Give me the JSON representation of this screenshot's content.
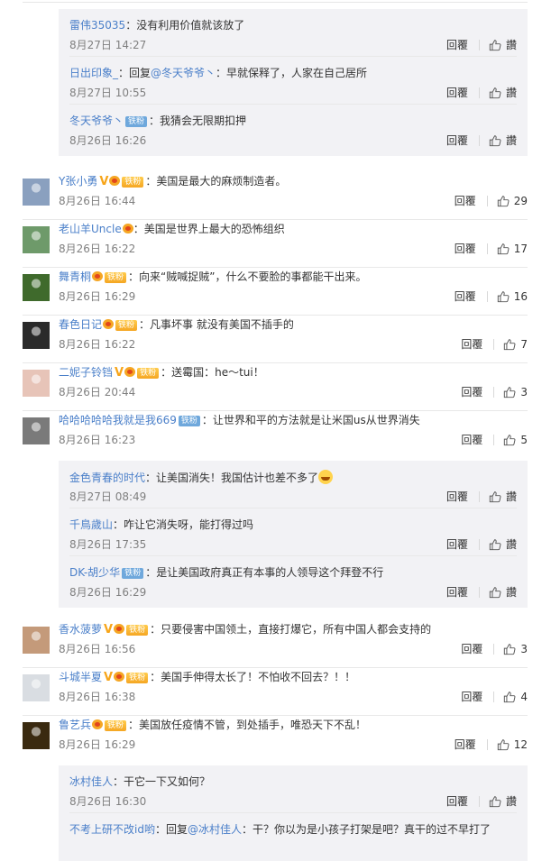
{
  "reply_label": "回覆",
  "like_label": "讚",
  "top_items": [
    {
      "name": "雷伟35035",
      "badges": [],
      "text": "：没有利用价值就该放了",
      "time": "8月27日 14:27"
    },
    {
      "name": "日出印象_",
      "badges": [],
      "text": "：回复",
      "mention": "@冬天爷爷丶",
      "text2": "：早就保释了，人家在自己居所",
      "time": "8月27日 10:55"
    },
    {
      "name": "冬天爷爷丶",
      "badges": [
        "fan-blue"
      ],
      "text": "：我猜会无限期扣押",
      "time": "8月26日 16:26"
    }
  ],
  "fan_label": "铁粉",
  "comments": [
    {
      "name": "Y张小勇",
      "badges": [
        "v",
        "crown",
        "fan-gold"
      ],
      "text": "：美国是最大的麻烦制造者。",
      "time": "8月26日 16:44",
      "likes": "29",
      "avatar": "#8aa0bf",
      "replies": []
    },
    {
      "name": "老山羊Uncle",
      "badges": [
        "crown"
      ],
      "text": "：美国是世界上最大的恐怖组织",
      "time": "8月26日 16:22",
      "likes": "17",
      "avatar": "#6e9a6a",
      "replies": []
    },
    {
      "name": "舞青桐",
      "badges": [
        "crown",
        "fan-gold"
      ],
      "text": "：向来“贼喊捉贼”，什么不要脸的事都能干出来。",
      "time": "8月26日 16:29",
      "likes": "16",
      "avatar": "#3f6a2c",
      "replies": []
    },
    {
      "name": "春色日记",
      "badges": [
        "crown",
        "fan-gold"
      ],
      "text": "：凡事坏事 就没有美国不插手的",
      "time": "8月26日 16:22",
      "likes": "7",
      "avatar": "#2a2a2a",
      "replies": []
    },
    {
      "name": "二妮子铃铛",
      "badges": [
        "v",
        "crown",
        "fan-gold"
      ],
      "text": "：送霉国：he～tui！",
      "time": "8月26日 20:44",
      "likes": "3",
      "avatar": "#e7c4b8",
      "replies": []
    },
    {
      "name": "哈哈哈哈哈我就是我669",
      "badges": [
        "fan-blue"
      ],
      "text": "：让世界和平的方法就是让米国us从世界消失",
      "time": "8月26日 16:23",
      "likes": "5",
      "avatar": "#7a7a7a",
      "replies": [
        {
          "name": "金色青春的时代",
          "text": "：让美国消失！我国估计也差不多了",
          "emoji": true,
          "time": "8月27日 08:49"
        },
        {
          "name": "千鳥歲山",
          "text": "：咋让它消失呀，能打得过吗",
          "time": "8月26日 17:35"
        },
        {
          "name": "DK-胡少华",
          "badges": [
            "fan-blue"
          ],
          "text": "：是让美国政府真正有本事的人领导这个拜登不行",
          "time": "8月26日 16:29"
        }
      ]
    },
    {
      "name": "香水菠萝",
      "badges": [
        "v",
        "crown",
        "fan-gold"
      ],
      "text": "：只要侵害中国领土，直接打爆它，所有中国人都会支持的",
      "time": "8月26日 16:56",
      "likes": "3",
      "avatar": "#c49a7a",
      "replies": []
    },
    {
      "name": "斗城半夏",
      "badges": [
        "v",
        "crown",
        "fan-gold"
      ],
      "text": "：美国手伸得太长了！不怕收不回去？！！",
      "time": "8月26日 16:38",
      "likes": "4",
      "avatar": "#d9dde2",
      "replies": []
    },
    {
      "name": "鲁艺兵",
      "badges": [
        "crown",
        "fan-gold"
      ],
      "text": "：美国放任疫情不管，到处插手，唯恐天下不乱！",
      "time": "8月26日 16:29",
      "likes": "12",
      "avatar": "#3a2a10",
      "replies": [
        {
          "name": "冰村佳人",
          "text": "：干它一下又如何？",
          "time": "8月26日 16:30"
        },
        {
          "name": "不考上研不改id哟",
          "text": "：回复",
          "mention": "@冰村佳人",
          "text2": "：干？你以为是小孩子打架是吧？真干的过不早打了",
          "time": ""
        }
      ]
    }
  ],
  "colors": {
    "link": "#4a7fc9",
    "reply_bg": "#f2f2f5",
    "divider": "#e8e8e8",
    "badge_v": "#f7a51a"
  }
}
